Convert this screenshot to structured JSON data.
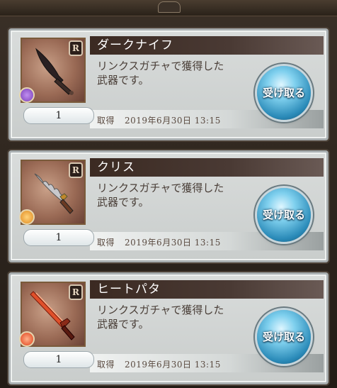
{
  "items": [
    {
      "name": "ダークナイフ",
      "rarity": "R",
      "element_color": "#7a3fb8",
      "element_icon": "dark-element-icon",
      "weapon_icon": "knife-icon",
      "description_line1": "リンクスガチャで獲得した",
      "description_line2": "武器です。",
      "count": "1",
      "acquired_label": "取得",
      "acquired_date": "2019年6月30日 13:15",
      "button_label": "受け取る"
    },
    {
      "name": "クリス",
      "rarity": "R",
      "element_color": "#e08a20",
      "element_icon": "earth-element-icon",
      "weapon_icon": "kris-dagger-icon",
      "description_line1": "リンクスガチャで獲得した",
      "description_line2": "武器です。",
      "count": "1",
      "acquired_label": "取得",
      "acquired_date": "2019年6月30日 13:15",
      "button_label": "受け取る"
    },
    {
      "name": "ヒートパタ",
      "rarity": "R",
      "element_color": "#e0401a",
      "element_icon": "fire-element-icon",
      "weapon_icon": "pata-sword-icon",
      "description_line1": "リンクスガチャで獲得した",
      "description_line2": "武器です。",
      "count": "1",
      "acquired_label": "取得",
      "acquired_date": "2019年6月30日 13:15",
      "button_label": "受け取る"
    }
  ]
}
